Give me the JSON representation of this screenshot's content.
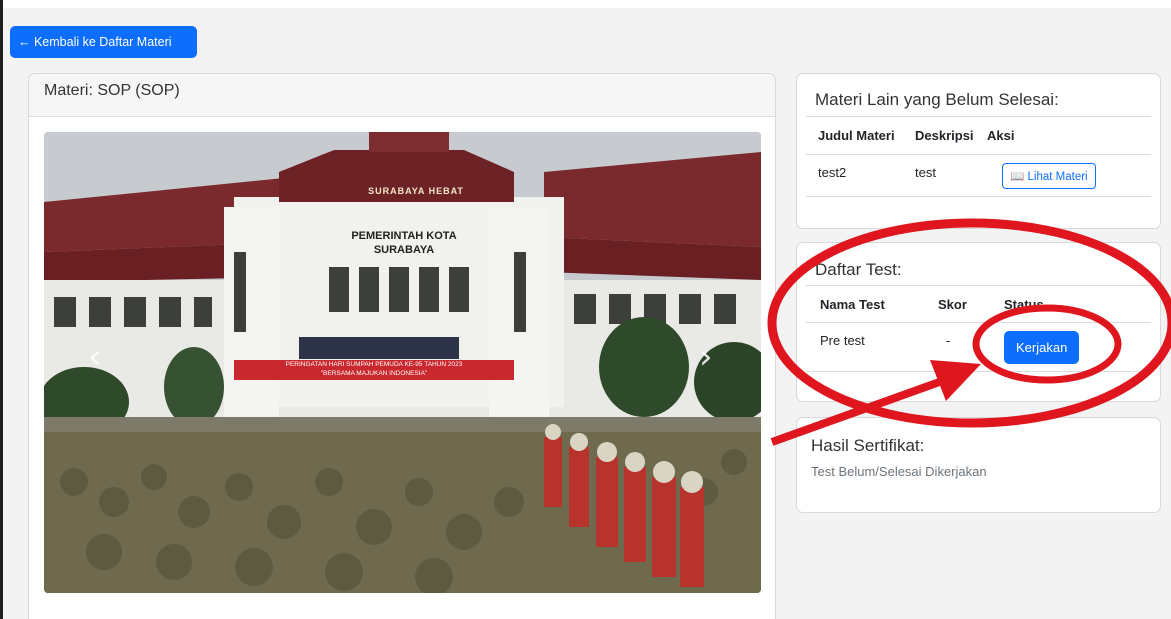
{
  "back_button": {
    "label": "← Kembali ke Daftar Materi"
  },
  "materi": {
    "header": "Materi: SOP (SOP)",
    "photo_alt": "",
    "photo_texts": {
      "building_sign_1": "PEMERINTAH KOTA",
      "building_sign_2": "SURABAYA",
      "crest_text": "SURABAYA HEBAT",
      "banner_1": "PERINGATAN HARI SUMPAH PEMUDA KE-95 TAHUN 2023",
      "banner_2": "\"BERSAMA MAJUKAN INDONESIA\""
    }
  },
  "other_materi": {
    "title": "Materi Lain yang Belum Selesai:",
    "columns": [
      "Judul Materi",
      "Deskripsi",
      "Aksi"
    ],
    "rows": [
      {
        "judul": "test2",
        "deskripsi": "test",
        "aksi": "📖 Lihat Materi"
      }
    ]
  },
  "tests": {
    "title": "Daftar Test:",
    "columns": [
      "Nama Test",
      "Skor",
      "Status"
    ],
    "rows": [
      {
        "nama": "Pre test",
        "skor": "-",
        "status": "Kerjakan"
      }
    ]
  },
  "certificate": {
    "title": "Hasil Sertifikat:",
    "status": "Test Belum/Selesai Dikerjakan"
  },
  "colors": {
    "primary": "#0d6efd",
    "annotation_red": "#e0161e"
  }
}
